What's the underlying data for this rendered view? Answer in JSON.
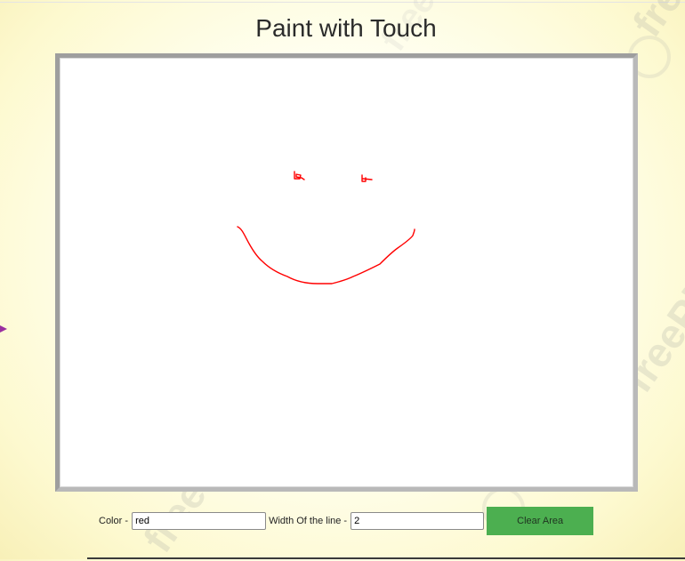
{
  "page": {
    "title": "Paint with Touch"
  },
  "canvas": {
    "stroke_color": "#ff0000",
    "background": "#ffffff"
  },
  "controls": {
    "color_label": "Color - ",
    "color_value": "red",
    "width_label": "Width Of the line - ",
    "width_value": "2",
    "clear_button_label": "Clear Area",
    "button_color": "#4caf50"
  },
  "watermark": {
    "text": "freePic"
  }
}
